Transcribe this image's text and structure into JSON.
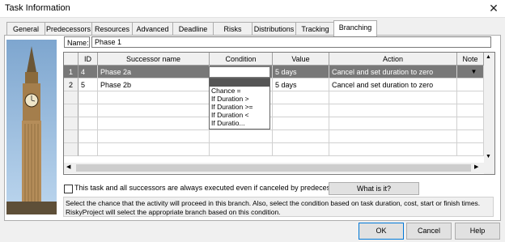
{
  "window": {
    "title": "Task Information",
    "close": "✕"
  },
  "tabs": [
    "General",
    "Predecessors",
    "Resources",
    "Advanced",
    "Deadline",
    "Risks",
    "Distributions",
    "Tracking",
    "Branching"
  ],
  "active_tab": "Branching",
  "name": {
    "label": "Name:",
    "value": "Phase 1"
  },
  "grid": {
    "columns": [
      "ID",
      "Successor name",
      "Condition",
      "Value",
      "Action",
      "Note"
    ],
    "rows": [
      {
        "row": "1",
        "id": "4",
        "successor": "Phase 2a",
        "condition": "",
        "value": "5 days",
        "action": "Cancel and set duration to zero",
        "note": ""
      },
      {
        "row": "2",
        "id": "5",
        "successor": "Phase 2b",
        "condition": "",
        "value": "5 days",
        "action": "Cancel and set duration to zero",
        "note": ""
      }
    ]
  },
  "condition_dropdown": {
    "options": [
      "",
      "Chance =",
      "If Duration >",
      "If Duration >=",
      "If Duration <",
      "If Duratio..."
    ]
  },
  "checkbox": {
    "label": "This task and all successors are always executed even if canceled by predecessors",
    "checked": false
  },
  "what_is_it": "What is it?",
  "info_text": "Select the chance that the activity will proceed in this branch. Also, select the condition based on task duration, cost, start or finish times. RiskyProject will select the appropriate branch based on this condition.",
  "buttons": {
    "ok": "OK",
    "cancel": "Cancel",
    "help": "Help"
  }
}
